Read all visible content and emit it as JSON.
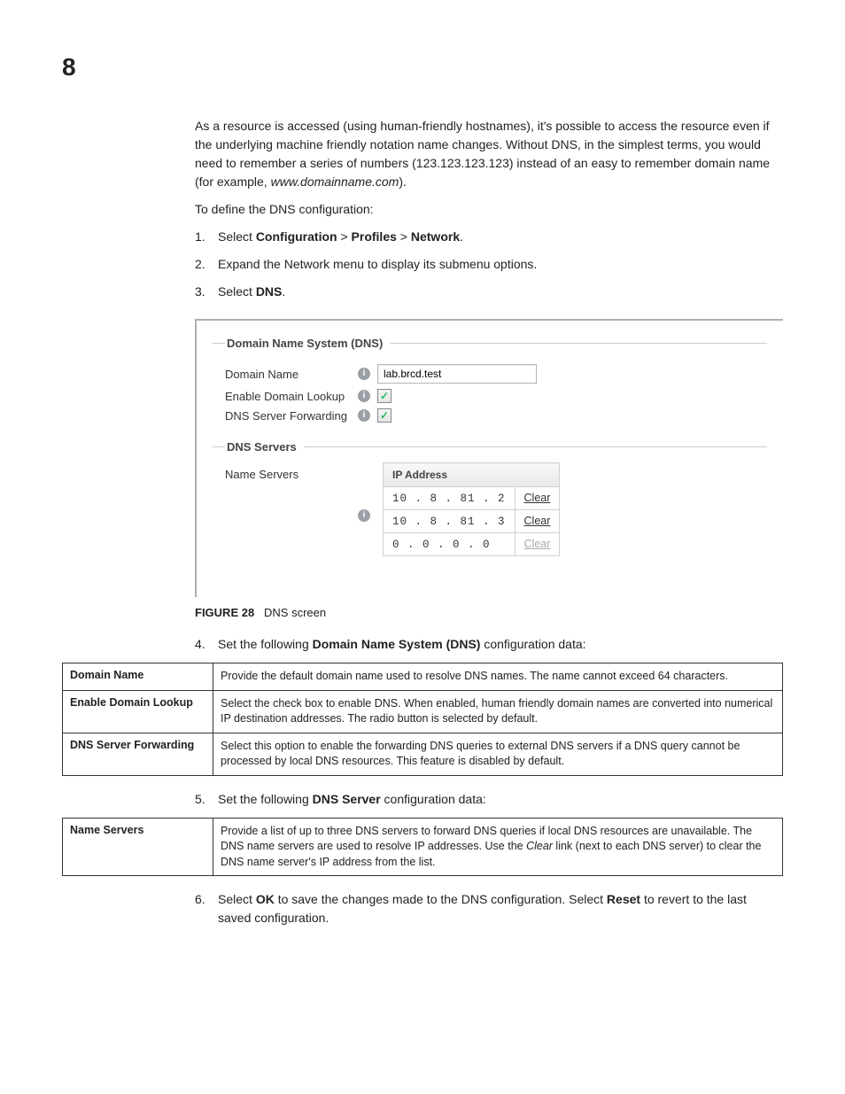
{
  "page": {
    "chapter_number": "8"
  },
  "intro_para": "As a resource is accessed (using human-friendly hostnames), it's possible to access the resource even if the underlying machine friendly notation name changes. Without DNS, in the simplest terms, you would need to remember a series of numbers (123.123.123.123) instead of an easy to remember domain name (for example, ",
  "intro_example": "www.domainname.com",
  "intro_tail": ").",
  "define_line": "To define the DNS configuration:",
  "steps": {
    "s1_pre": "Select ",
    "s1_b1": "Configuration",
    "s1_mid1": " > ",
    "s1_b2": "Profiles",
    "s1_mid2": " > ",
    "s1_b3": "Network",
    "s1_tail": ".",
    "s2": "Expand the Network menu to display its submenu options.",
    "s3_pre": "Select ",
    "s3_b": "DNS",
    "s3_tail": ".",
    "s4_pre": "Set the following ",
    "s4_b": "Domain Name System (DNS)",
    "s4_tail": " configuration data:",
    "s5_pre": "Set the following ",
    "s5_b": "DNS Server",
    "s5_tail": " configuration data:",
    "s6_pre": "Select ",
    "s6_b1": "OK",
    "s6_mid": " to save the changes made to the DNS configuration. Select ",
    "s6_b2": "Reset",
    "s6_tail": " to revert to the last saved configuration."
  },
  "screenshot": {
    "legend_dns": "Domain Name System (DNS)",
    "legend_servers": "DNS Servers",
    "labels": {
      "domain_name": "Domain Name",
      "enable_lookup": "Enable Domain Lookup",
      "forwarding": "DNS Server Forwarding",
      "name_servers": "Name Servers"
    },
    "domain_value": "lab.brcd.test",
    "ip_header": "IP Address",
    "ips": [
      "10 .  8 . 81 .  2",
      "10 .  8 . 81 .  3",
      " 0 .  0 .  0 .  0"
    ],
    "clear": "Clear"
  },
  "figure": {
    "num": "FIGURE 28",
    "caption": "DNS screen"
  },
  "table1": {
    "r1h": "Domain Name",
    "r1d": "Provide the default domain name used to resolve DNS names. The name cannot exceed 64 characters.",
    "r2h": "Enable Domain Lookup",
    "r2d": "Select the check box to enable DNS. When enabled, human friendly domain names are converted into numerical IP destination addresses. The radio button is selected by default.",
    "r3h": "DNS Server Forwarding",
    "r3d": "Select this option to enable the forwarding DNS queries to external DNS servers if a DNS query cannot be processed by local DNS resources. This feature is disabled by default."
  },
  "table2": {
    "r1h": "Name Servers",
    "r1d_pre": "Provide a list of up to three DNS servers to forward DNS queries if local DNS resources are unavailable. The DNS name servers are used to resolve IP addresses. Use the ",
    "r1d_it": "Clear",
    "r1d_post": " link (next to each DNS server) to clear the DNS name server's IP address from the list."
  }
}
